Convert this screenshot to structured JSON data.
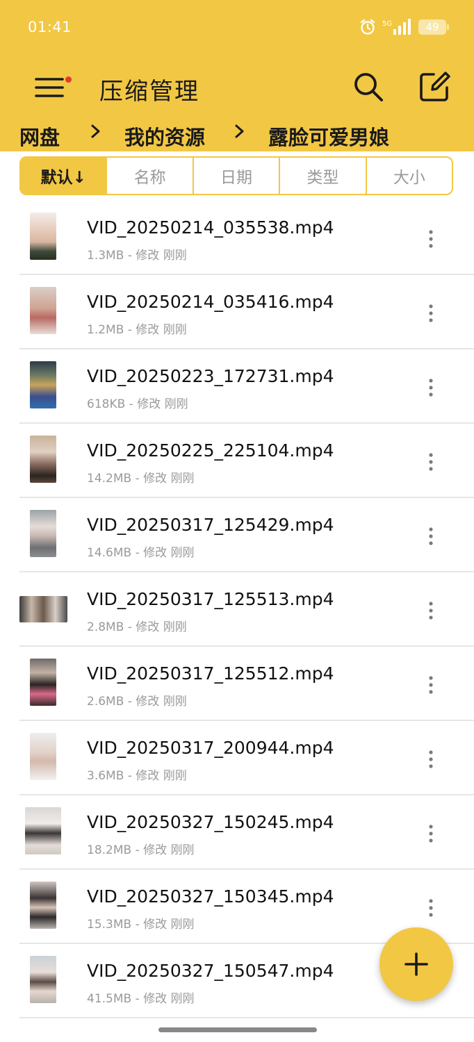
{
  "status_bar": {
    "time": "01:41",
    "network": "5G",
    "battery": "49"
  },
  "app_bar": {
    "title": "压缩管理",
    "menu_icon": "menu-icon",
    "search_icon": "search-icon",
    "edit_icon": "edit-icon"
  },
  "breadcrumb": [
    "网盘",
    "我的资源",
    "露脸可爱男娘"
  ],
  "sort_tabs": [
    "默认↓",
    "名称",
    "日期",
    "类型",
    "大小"
  ],
  "files": [
    {
      "name": "VID_20250214_035538.mp4",
      "meta": "1.3MB - 修改 刚刚"
    },
    {
      "name": "VID_20250214_035416.mp4",
      "meta": "1.2MB - 修改 刚刚"
    },
    {
      "name": "VID_20250223_172731.mp4",
      "meta": "618KB - 修改 刚刚"
    },
    {
      "name": "VID_20250225_225104.mp4",
      "meta": "14.2MB - 修改 刚刚"
    },
    {
      "name": "VID_20250317_125429.mp4",
      "meta": "14.6MB - 修改 刚刚"
    },
    {
      "name": "VID_20250317_125513.mp4",
      "meta": "2.8MB - 修改 刚刚"
    },
    {
      "name": "VID_20250317_125512.mp4",
      "meta": "2.6MB - 修改 刚刚"
    },
    {
      "name": "VID_20250317_200944.mp4",
      "meta": "3.6MB - 修改 刚刚"
    },
    {
      "name": "VID_20250327_150245.mp4",
      "meta": "18.2MB - 修改 刚刚"
    },
    {
      "name": "VID_20250327_150345.mp4",
      "meta": "15.3MB - 修改 刚刚"
    },
    {
      "name": "VID_20250327_150547.mp4",
      "meta": "41.5MB - 修改 刚刚"
    }
  ],
  "fab": {
    "icon": "plus-icon"
  },
  "colors": {
    "accent": "#f2c744",
    "notification_dot": "#e53935",
    "divider": "#e6e6e6",
    "secondary_text": "#9a9a9a"
  }
}
